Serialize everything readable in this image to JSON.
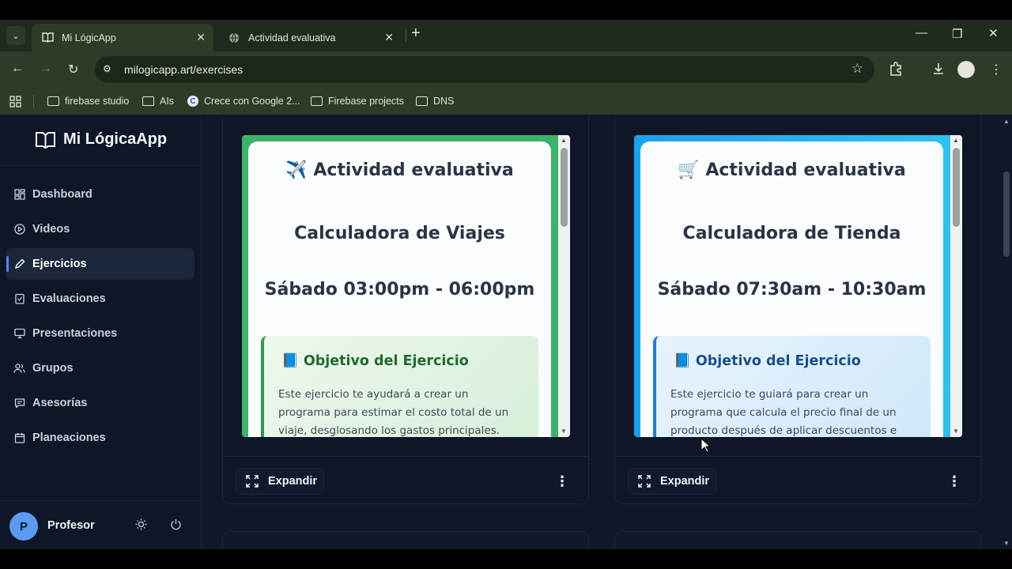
{
  "browser": {
    "tabs": [
      {
        "title": "Mi LógicApp",
        "icon": "book-icon",
        "active": true
      },
      {
        "title": "Actividad evaluativa",
        "icon": "globe-icon",
        "active": false
      }
    ],
    "url": "milogicapp.art/exercises",
    "bookmarks": [
      {
        "label": "firebase studio",
        "icon": "folder-icon"
      },
      {
        "label": "AIs",
        "icon": "folder-icon"
      },
      {
        "label": "Crece con Google 2...",
        "icon": "c-icon"
      },
      {
        "label": "Firebase projects",
        "icon": "folder-icon"
      },
      {
        "label": "DNS",
        "icon": "folder-icon"
      }
    ]
  },
  "app": {
    "brand": "Mi LógicaApp",
    "nav": [
      {
        "label": "Dashboard",
        "icon": "grid-icon",
        "active": false
      },
      {
        "label": "Videos",
        "icon": "play-circle-icon",
        "active": false
      },
      {
        "label": "Ejercicios",
        "icon": "pencil-icon",
        "active": true
      },
      {
        "label": "Evaluaciones",
        "icon": "clipboard-icon",
        "active": false
      },
      {
        "label": "Presentaciones",
        "icon": "presentation-icon",
        "active": false
      },
      {
        "label": "Grupos",
        "icon": "users-icon",
        "active": false
      },
      {
        "label": "Asesorías",
        "icon": "chat-icon",
        "active": false
      },
      {
        "label": "Planeaciones",
        "icon": "calendar-icon",
        "active": false
      }
    ],
    "user": {
      "initial": "P",
      "name": "Profesor"
    }
  },
  "cards": [
    {
      "heading": "Actividad evaluativa",
      "heading_emoji": "✈️",
      "title": "Calculadora de Viajes",
      "schedule": "Sábado 03:00pm - 06:00pm",
      "objective_emoji": "📘",
      "objective_title": "Objetivo del Ejercicio",
      "objective_text": "Este ejercicio te ayudará a crear un programa para estimar el costo total de un viaje, desglosando los gastos principales.",
      "accent": "#3bb36a",
      "objective_color": "#1e6b2e",
      "expand_label": "Expandir"
    },
    {
      "heading": "Actividad evaluativa",
      "heading_emoji": "🛒",
      "title": "Calculadora de Tienda",
      "schedule": "Sábado 07:30am - 10:30am",
      "objective_emoji": "📘",
      "objective_title": "Objetivo del Ejercicio",
      "objective_text": "Este ejercicio te guiará para crear un programa que calcula el precio final de un producto después de aplicar descuentos e impuestos.",
      "accent": "#1aa9ea",
      "objective_color": "#1a4f8c",
      "expand_label": "Expandir"
    }
  ]
}
